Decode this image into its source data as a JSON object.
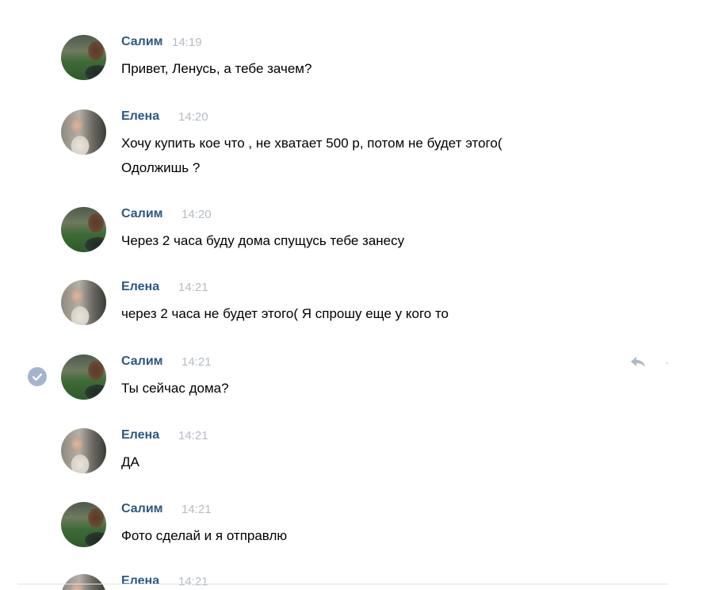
{
  "messages": [
    {
      "author": "Салим",
      "time": "14:19",
      "text": "Привет, Ленусь, а тебе зачем?"
    },
    {
      "author": "Елена",
      "time": "14:20",
      "text": "Хочу купить кое что , не хватает 500 р, потом не будет этого(\nОдолжишь ?"
    },
    {
      "author": "Салим",
      "time": "14:20",
      "text": "Через 2 часа буду дома спущусь тебе занесу"
    },
    {
      "author": "Елена",
      "time": "14:21",
      "text": "через 2 часа не будет этого( Я спрошу еще у кого то"
    },
    {
      "author": "Салим",
      "time": "14:21",
      "text": "Ты сейчас дома?"
    },
    {
      "author": "Елена",
      "time": "14:21",
      "text": "ДА"
    },
    {
      "author": "Салим",
      "time": "14:21",
      "text": "Фото сделай и я отправлю"
    },
    {
      "author": "Елена",
      "time": "14:21",
      "text": ""
    }
  ],
  "icons": {
    "selected": "checkmark-icon",
    "reply": "reply-icon",
    "more": "more-icon"
  },
  "colors": {
    "author": "#2a5885",
    "time": "#b5bcc5",
    "text": "#000000",
    "check": "#a3b5cc"
  }
}
